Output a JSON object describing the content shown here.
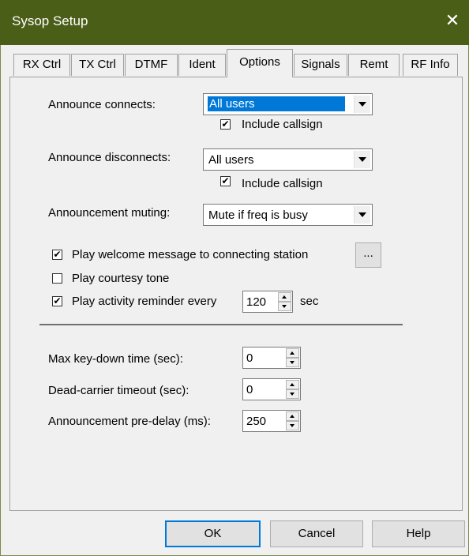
{
  "window": {
    "title": "Sysop Setup",
    "close_glyph": "✕"
  },
  "tabs": [
    "RX Ctrl",
    "TX Ctrl",
    "DTMF",
    "Ident",
    "Options",
    "Signals",
    "Remt",
    "RF Info"
  ],
  "active_tab": "Options",
  "options": {
    "announce_connects": {
      "label": "Announce connects:",
      "value": "All users",
      "include_label": "Include callsign",
      "include_checked": true
    },
    "announce_disconnects": {
      "label": "Announce disconnects:",
      "value": "All users",
      "include_label": "Include callsign",
      "include_checked": true
    },
    "muting": {
      "label": "Announcement muting:",
      "value": "Mute if freq is busy"
    },
    "welcome": {
      "label": "Play welcome message to connecting station",
      "checked": true,
      "browse_label": "..."
    },
    "courtesy": {
      "label": "Play courtesy tone",
      "checked": false
    },
    "reminder": {
      "label": "Play activity reminder every",
      "checked": true,
      "value": "120",
      "unit": "sec"
    },
    "max_keydown": {
      "label": "Max key-down time (sec):",
      "value": "0"
    },
    "dead_carrier": {
      "label": "Dead-carrier timeout (sec):",
      "value": "0"
    },
    "pre_delay": {
      "label": "Announcement pre-delay (ms):",
      "value": "250"
    }
  },
  "buttons": {
    "ok": "OK",
    "cancel": "Cancel",
    "help": "Help"
  },
  "colors": {
    "titlebar": "#4a5e17",
    "selection": "#0078d7"
  },
  "icons": {
    "close": "close-icon",
    "check": "check-icon"
  }
}
